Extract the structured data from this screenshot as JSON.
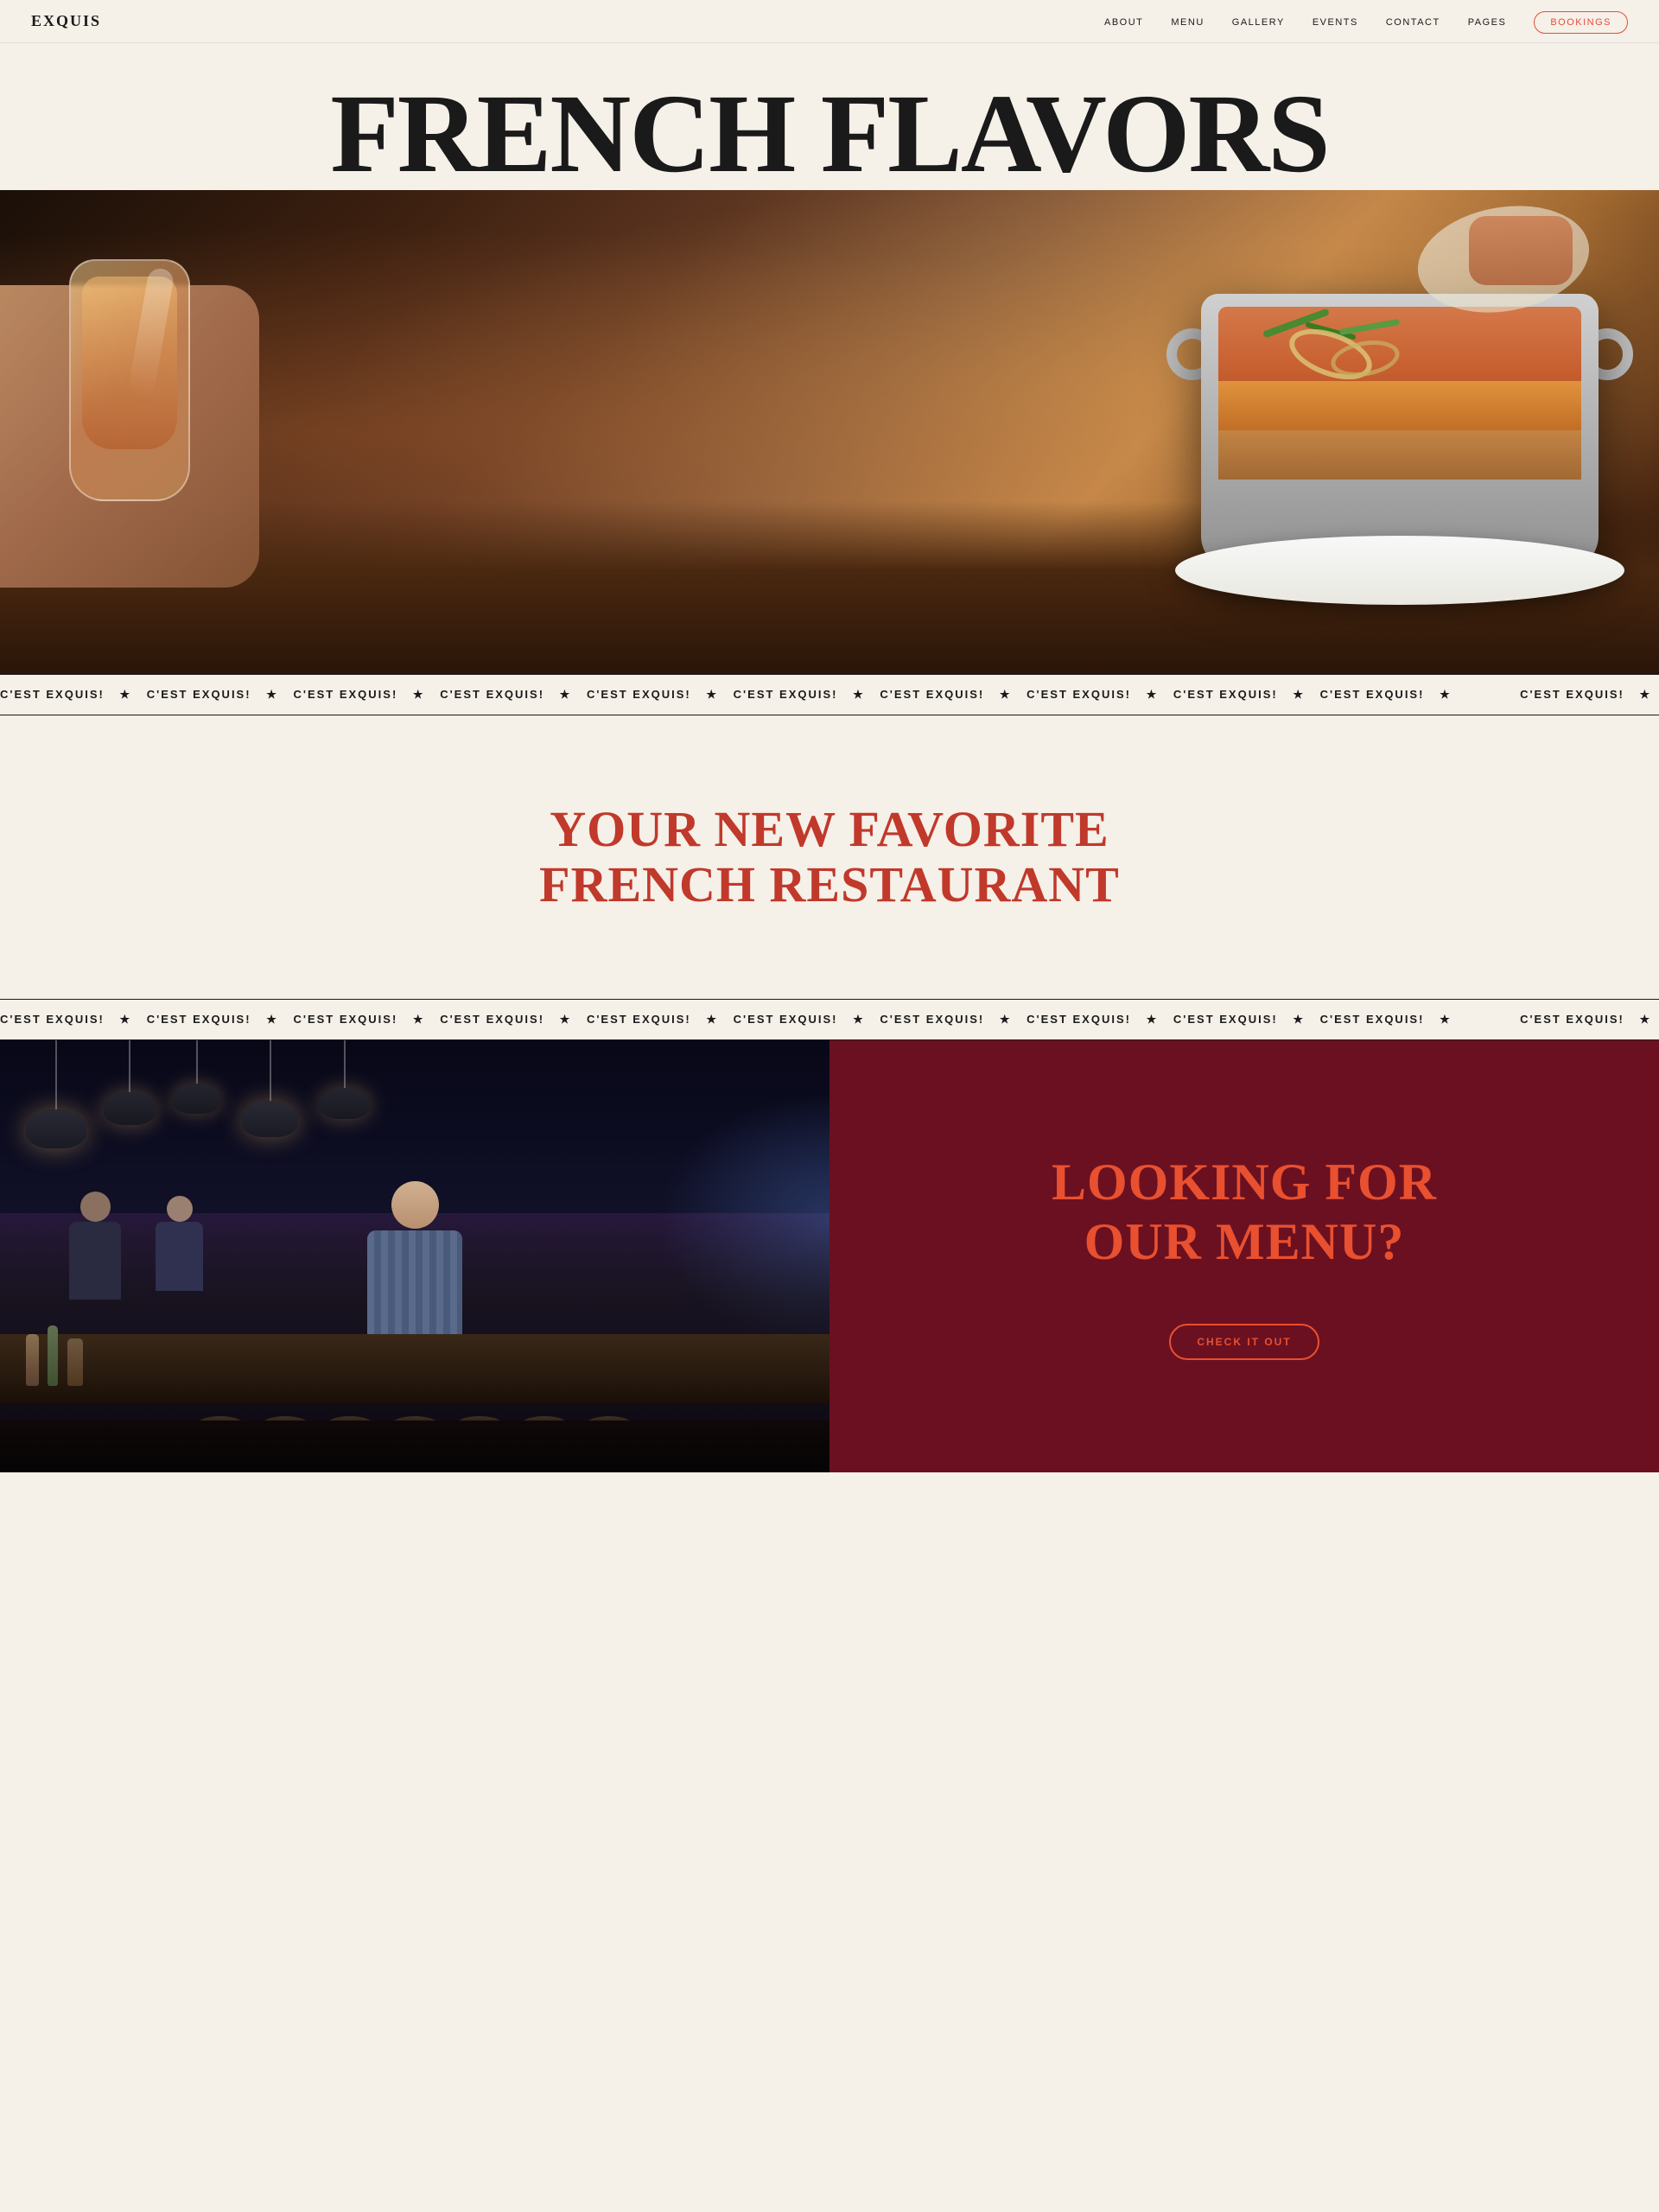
{
  "nav": {
    "logo": "EXQUIS",
    "links": [
      {
        "label": "ABOUT",
        "id": "about"
      },
      {
        "label": "MENU",
        "id": "menu"
      },
      {
        "label": "GALLERY",
        "id": "gallery"
      },
      {
        "label": "EVENTS",
        "id": "events"
      },
      {
        "label": "CONTACT",
        "id": "contact"
      },
      {
        "label": "PAGES",
        "id": "pages"
      }
    ],
    "bookings_label": "BOOKINGS"
  },
  "hero": {
    "title_line1": "FRENCH FLAVORS"
  },
  "marquee1": {
    "text_unit": "C'EST EXQUIS!",
    "separator": "★"
  },
  "middle": {
    "headline_line1": "YOUR NEW FAVORITE",
    "headline_line2": "FRENCH RESTAURANT"
  },
  "marquee2": {
    "text_unit": "C'EST EXQUIS!",
    "separator": "★"
  },
  "bottom_right": {
    "headline_line1": "LOOKING FOR",
    "headline_line2": "OUR MENU?",
    "cta_label": "CHECK IT OUT"
  },
  "colors": {
    "background": "#f5f0e8",
    "dark": "#1a1a1a",
    "red": "#e85030",
    "dark_red": "#6b1020",
    "bookings_border": "#e74c3c"
  }
}
